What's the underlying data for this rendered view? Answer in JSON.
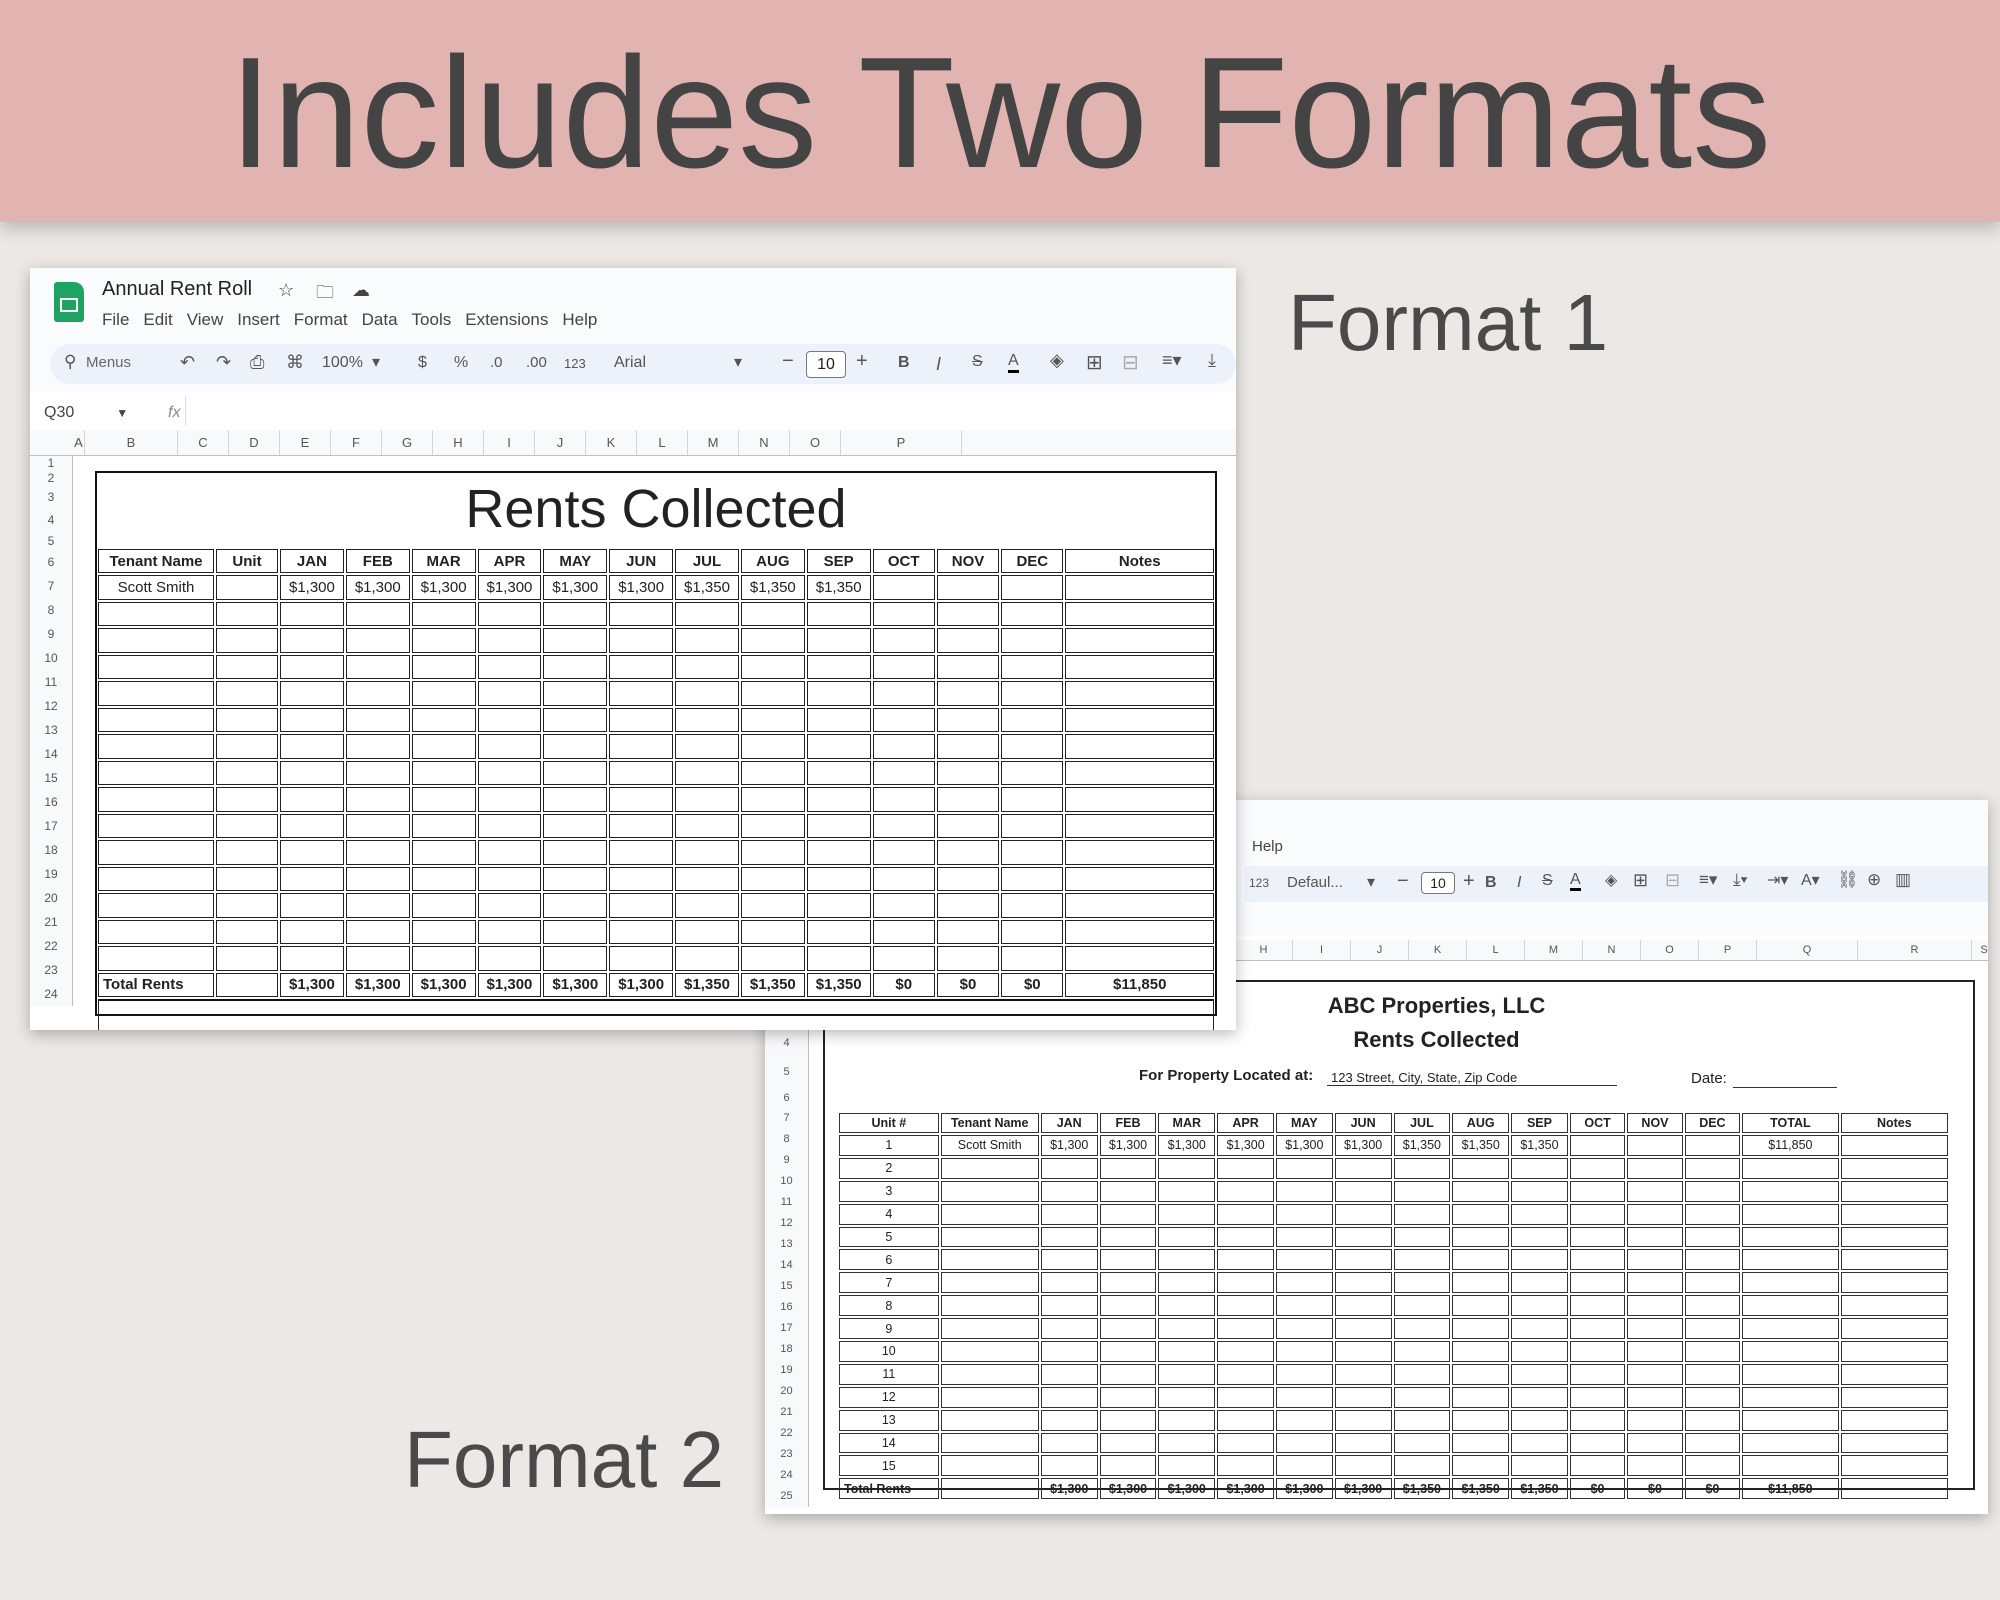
{
  "banner": {
    "title": "Includes Two Formats"
  },
  "labels": {
    "format1": "Format 1",
    "format2": "Format 2"
  },
  "sheet1": {
    "doc_title": "Annual Rent Roll",
    "menus": [
      "File",
      "Edit",
      "View",
      "Insert",
      "Format",
      "Data",
      "Tools",
      "Extensions",
      "Help"
    ],
    "toolbar": {
      "search": "Menus",
      "zoom": "100%",
      "currency": "$",
      "percent": "%",
      "dec_dec": ".0",
      "dec_inc": ".00",
      "num_format": "123",
      "font": "Arial",
      "font_size": "10",
      "bold": "B",
      "italic": "I",
      "text_color": "A"
    },
    "name_box": "Q30",
    "fx": "fx",
    "columns": [
      "A",
      "B",
      "C",
      "D",
      "E",
      "F",
      "G",
      "H",
      "I",
      "J",
      "K",
      "L",
      "M",
      "N",
      "O",
      "P"
    ],
    "rows": [
      "1",
      "2",
      "3",
      "4",
      "5",
      "6",
      "7",
      "8",
      "9",
      "10",
      "11",
      "12",
      "13",
      "14",
      "15",
      "16",
      "17",
      "18",
      "19",
      "20",
      "21",
      "22",
      "23",
      "24"
    ],
    "title": "Rents Collected",
    "headers": [
      "Tenant Name",
      "Unit",
      "JAN",
      "FEB",
      "MAR",
      "APR",
      "MAY",
      "JUN",
      "JUL",
      "AUG",
      "SEP",
      "OCT",
      "NOV",
      "DEC",
      "Notes"
    ],
    "tenant": [
      "Scott Smith",
      "",
      "$1,300",
      "$1,300",
      "$1,300",
      "$1,300",
      "$1,300",
      "$1,300",
      "$1,350",
      "$1,350",
      "$1,350",
      "",
      "",
      "",
      ""
    ],
    "totals": [
      "Total Rents",
      "",
      "$1,300",
      "$1,300",
      "$1,300",
      "$1,300",
      "$1,300",
      "$1,300",
      "$1,350",
      "$1,350",
      "$1,350",
      "$0",
      "$0",
      "$0",
      "$11,850"
    ]
  },
  "sheet2": {
    "menu_help": "Help",
    "toolbar": {
      "num_format": "123",
      "font": "Defaul...",
      "font_size": "10",
      "bold": "B",
      "italic": "I",
      "text_color": "A"
    },
    "columns": [
      "H",
      "I",
      "J",
      "K",
      "L",
      "M",
      "N",
      "O",
      "P",
      "Q",
      "R",
      "S"
    ],
    "rows": [
      "4",
      "5",
      "6",
      "7",
      "8",
      "9",
      "10",
      "11",
      "12",
      "13",
      "14",
      "15",
      "16",
      "17",
      "18",
      "19",
      "20",
      "21",
      "22",
      "23",
      "24",
      "25"
    ],
    "company": "ABC Properties, LLC",
    "title": "Rents Collected",
    "property_label": "For Property Located at:",
    "property_value": "123 Street, City, State, Zip Code",
    "date_label": "Date:",
    "headers": [
      "Unit #",
      "Tenant Name",
      "JAN",
      "FEB",
      "MAR",
      "APR",
      "MAY",
      "JUN",
      "JUL",
      "AUG",
      "SEP",
      "OCT",
      "NOV",
      "DEC",
      "TOTAL",
      "Notes"
    ],
    "tenant": [
      "1",
      "Scott Smith",
      "$1,300",
      "$1,300",
      "$1,300",
      "$1,300",
      "$1,300",
      "$1,300",
      "$1,350",
      "$1,350",
      "$1,350",
      "",
      "",
      "",
      "$11,850",
      ""
    ],
    "units": [
      "2",
      "3",
      "4",
      "5",
      "6",
      "7",
      "8",
      "9",
      "10",
      "11",
      "12",
      "13",
      "14",
      "15"
    ],
    "totals": [
      "Total Rents",
      "",
      "$1,300",
      "$1,300",
      "$1,300",
      "$1,300",
      "$1,300",
      "$1,300",
      "$1,350",
      "$1,350",
      "$1,350",
      "$0",
      "$0",
      "$0",
      "$11,850",
      ""
    ]
  }
}
